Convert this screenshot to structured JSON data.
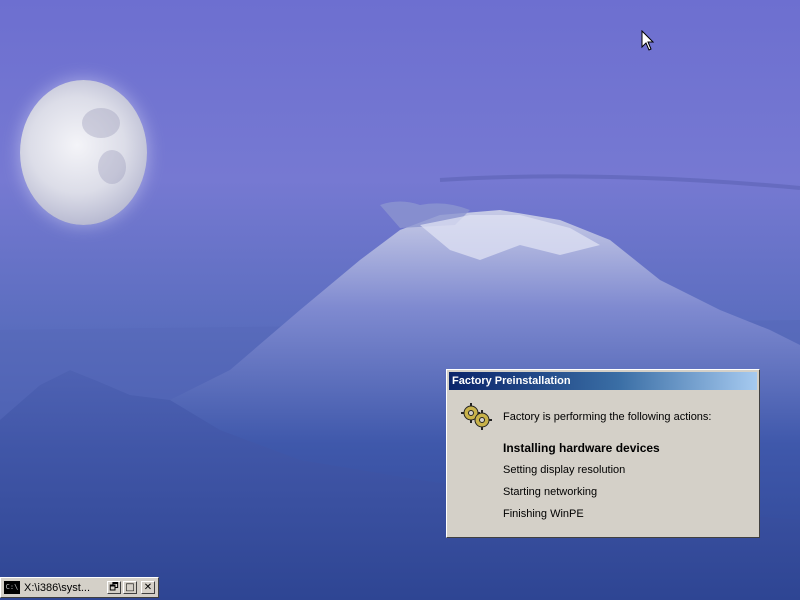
{
  "dialog": {
    "title": "Factory Preinstallation",
    "lead": "Factory is performing the following actions:",
    "steps": [
      "Installing hardware devices",
      "Setting display resolution",
      "Starting networking",
      "Finishing WinPE"
    ],
    "icon": "gears-icon"
  },
  "taskbar": {
    "window_title": "X:\\i386\\syst...",
    "icon": "cmd-icon",
    "icon_text": "C:\\",
    "restore_glyph": "🗗",
    "maximize_glyph": "□",
    "close_glyph": "✕"
  },
  "desktop": {
    "wallpaper": "moon-over-mountain",
    "colors": {
      "sky": "#6d6fd0",
      "mountain": "#3c55a8",
      "dialog_bg": "#d4d0c8",
      "titlebar": "#0a246a"
    }
  }
}
